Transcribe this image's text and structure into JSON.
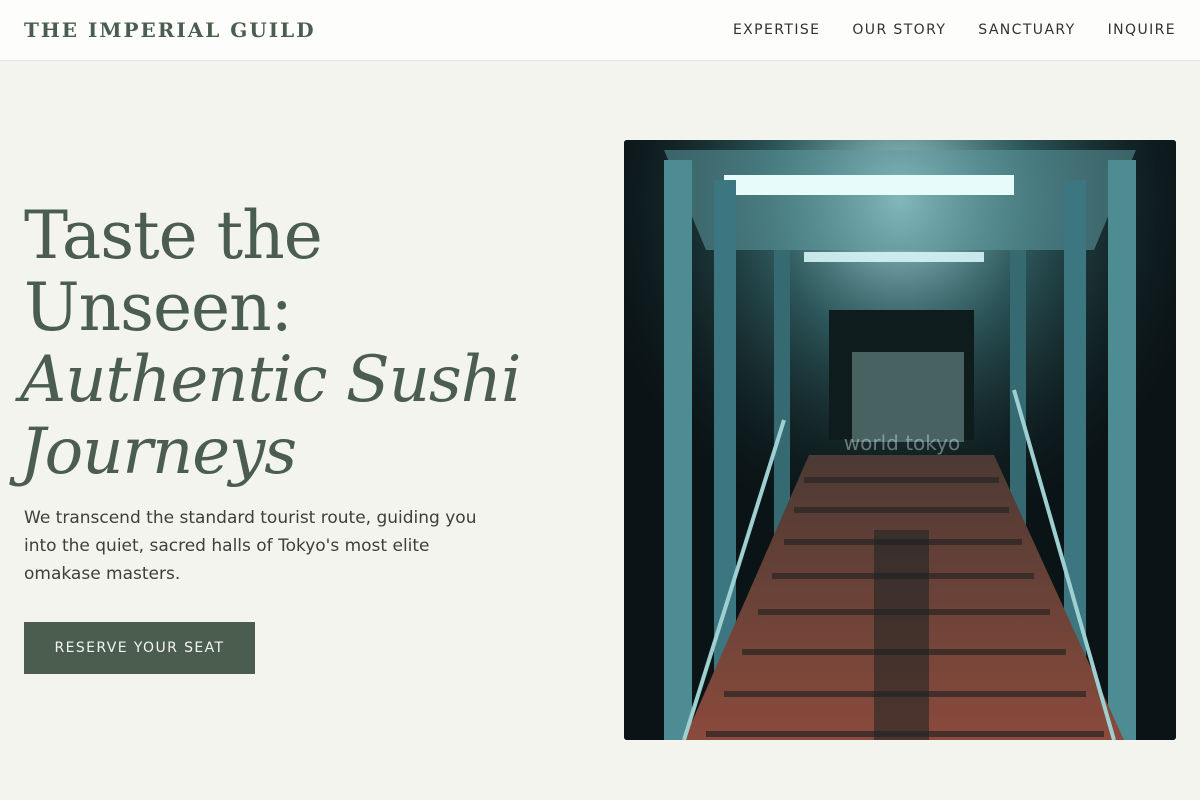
{
  "header": {
    "brand": "THE IMPERIAL GUILD",
    "nav": [
      {
        "label": "EXPERTISE"
      },
      {
        "label": "OUR STORY"
      },
      {
        "label": "SANCTUARY"
      },
      {
        "label": "INQUIRE"
      }
    ]
  },
  "hero": {
    "headline_line1": "Taste the",
    "headline_line2": "Unseen:",
    "headline_line3": "Authentic Sushi",
    "headline_line4": "Journeys",
    "lede": "We transcend the standard tourist route, guiding you into the quiet, sacred halls of Tokyo's most elite omakase masters.",
    "cta_label": "RESERVE YOUR SEAT",
    "image_watermark": "world tokyo"
  },
  "colors": {
    "brand_green": "#4a5d4e",
    "page_background": "#f4f4ef",
    "header_background": "#fdfdfb"
  }
}
